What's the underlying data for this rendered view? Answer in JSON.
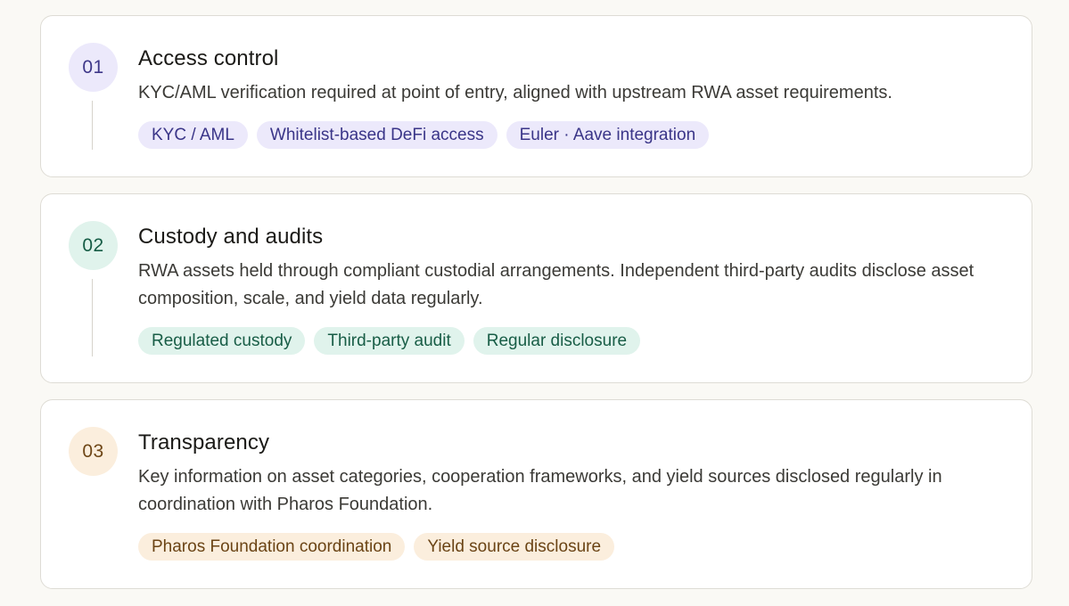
{
  "sections": [
    {
      "number": "01",
      "title": "Access control",
      "description": "KYC/AML verification required at point of entry, aligned with upstream RWA asset requirements.",
      "accent": "#ece9fb",
      "tags": [
        "KYC / AML",
        "Whitelist-based DeFi access",
        "Euler · Aave integration"
      ]
    },
    {
      "number": "02",
      "title": "Custody and audits",
      "description": "RWA assets held through compliant custodial arrangements. Independent third-party audits disclose asset composition, scale, and yield data regularly.",
      "accent": "#e0f3ec",
      "tags": [
        "Regulated custody",
        "Third-party audit",
        "Regular disclosure"
      ]
    },
    {
      "number": "03",
      "title": "Transparency",
      "description": "Key information on asset categories, cooperation frameworks, and yield sources disclosed regularly in coordination with Pharos Foundation.",
      "accent": "#fbeedd",
      "tags": [
        "Pharos Foundation coordination",
        "Yield source disclosure"
      ]
    }
  ]
}
